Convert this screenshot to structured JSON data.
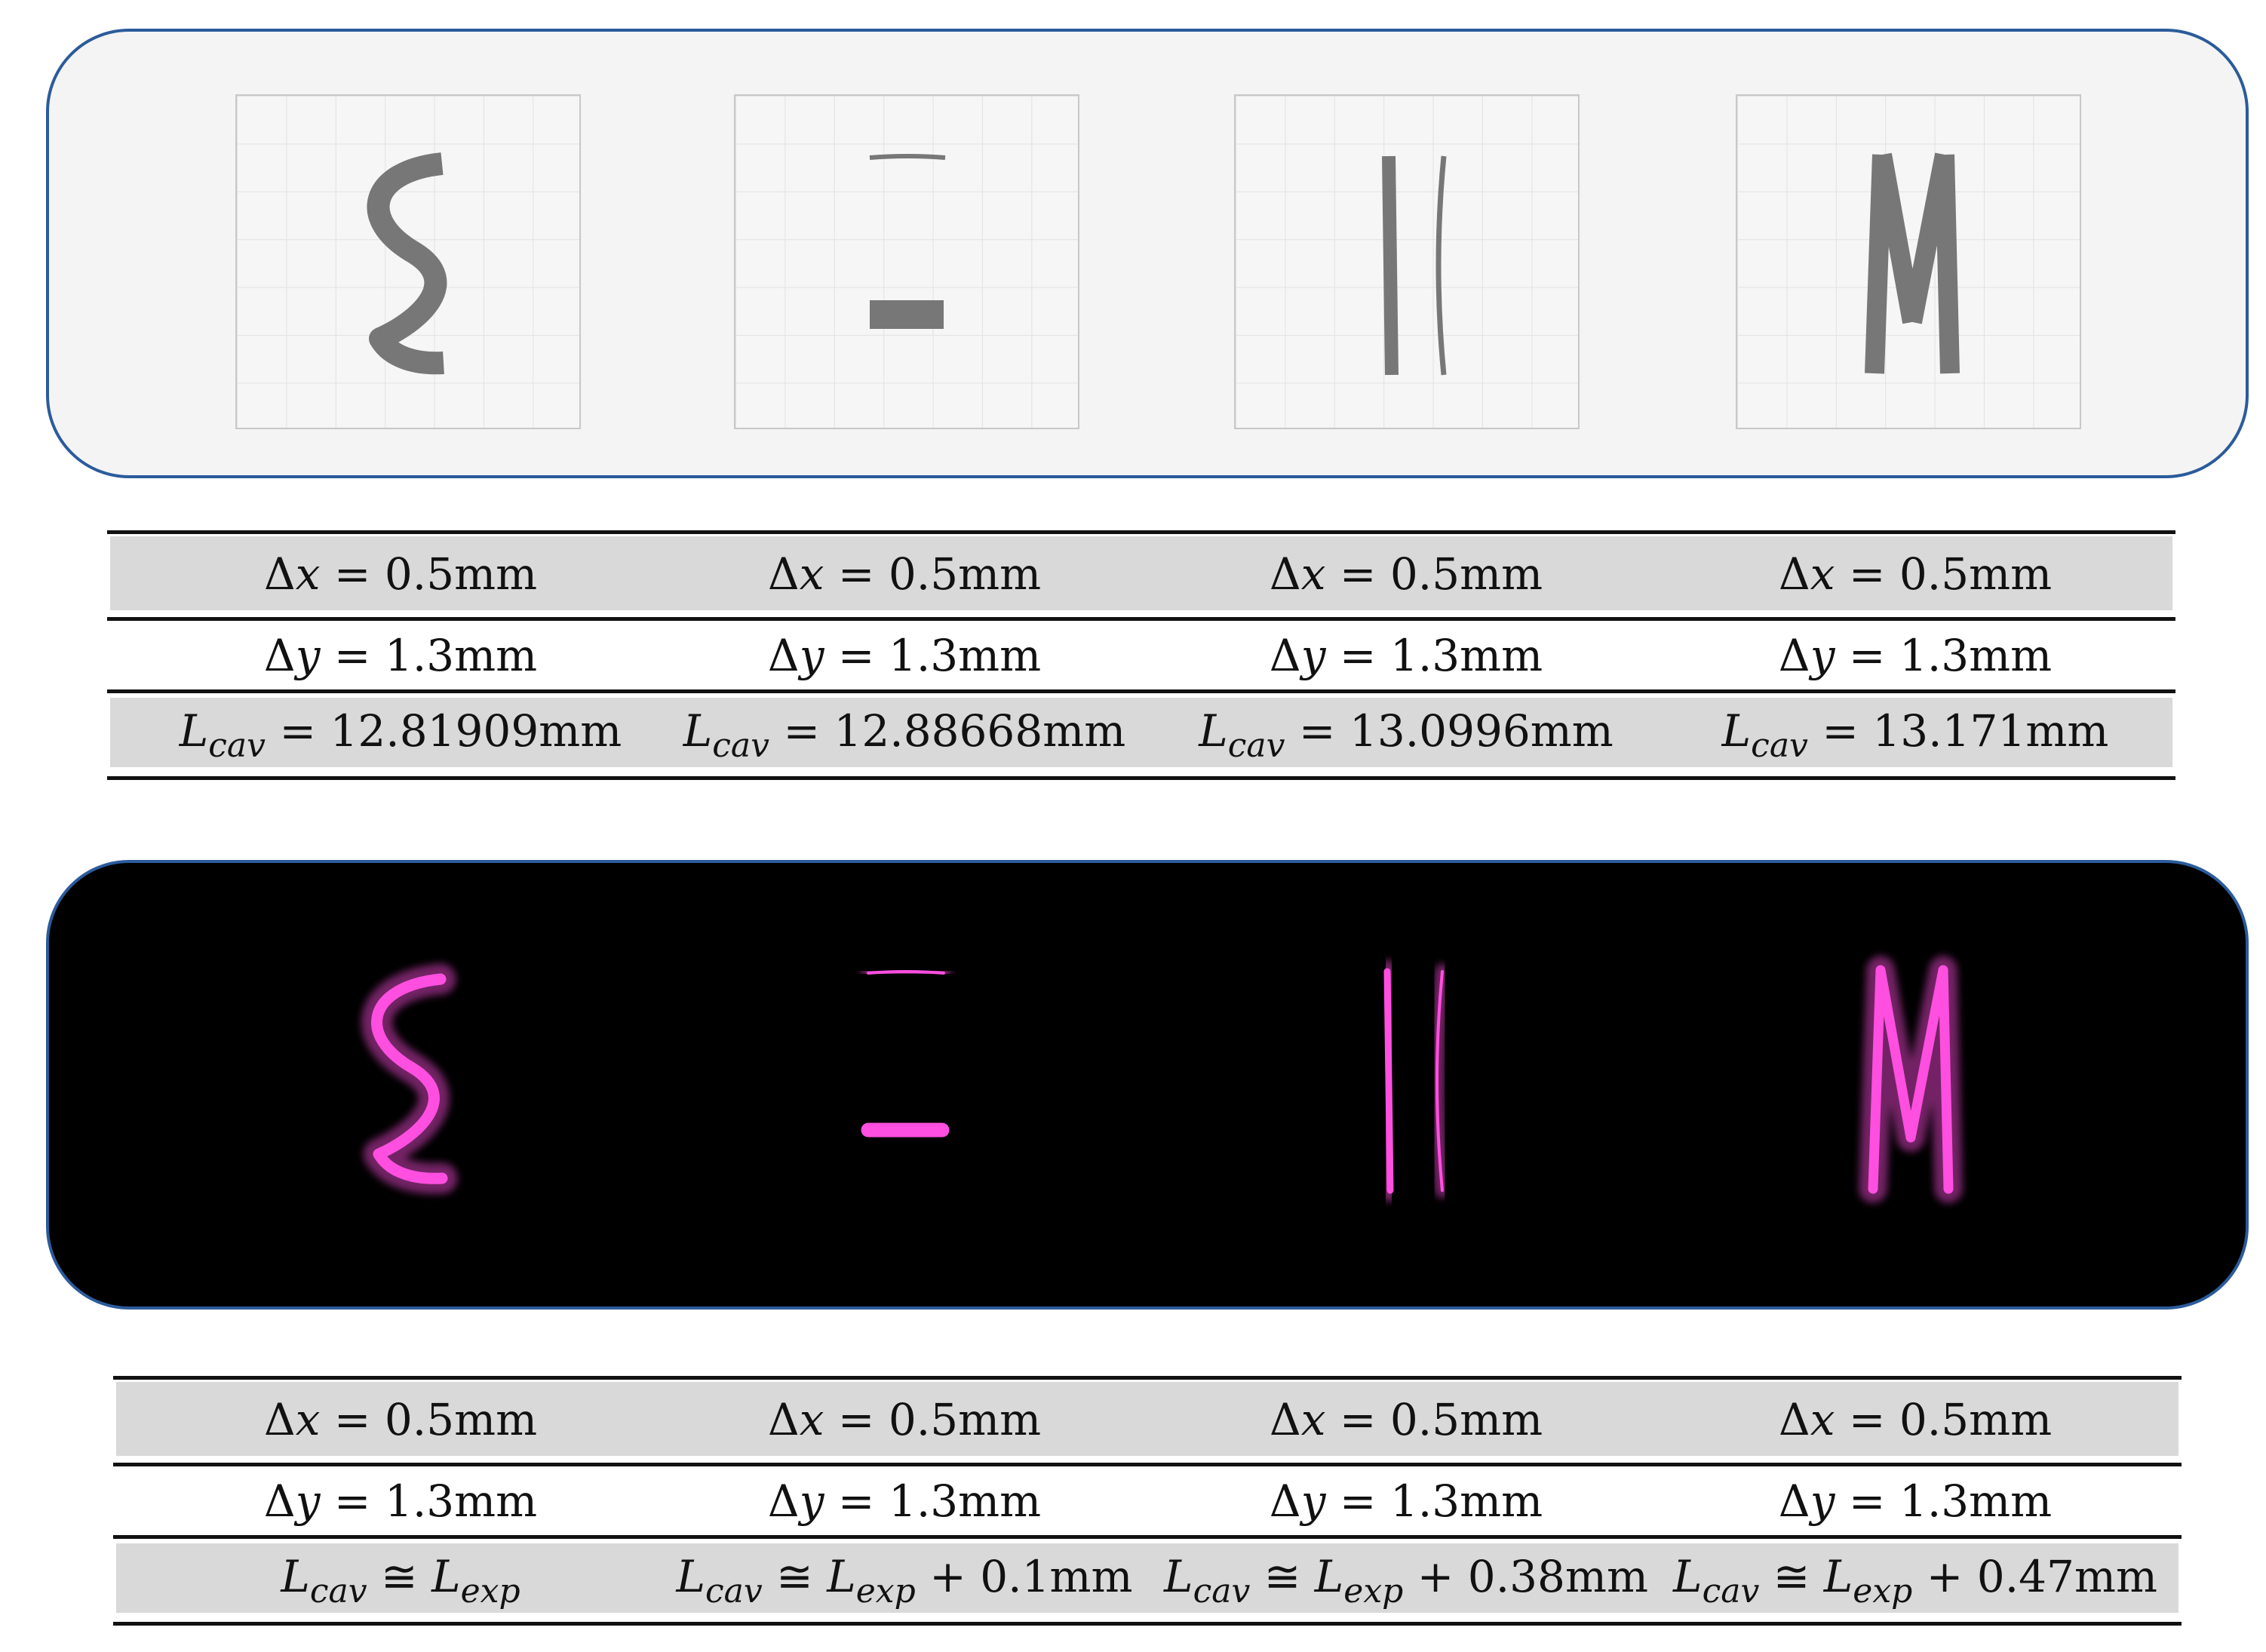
{
  "colors": {
    "panel_border": "#2b5b9b",
    "sim_shape": "#777777",
    "laser_glow": "#ff4fe0"
  },
  "simulation_panel": {
    "shapes": [
      "s-curve",
      "line-and-block",
      "two-vertical-lines",
      "m-shape"
    ]
  },
  "experiment_panel": {
    "shapes": [
      "s-curve",
      "line-and-block",
      "two-vertical-lines",
      "m-shape"
    ]
  },
  "table_top": {
    "rows": [
      [
        [
          {
            "t": "Δ"
          },
          {
            "i": "x"
          },
          {
            "t": " = 0.5mm"
          }
        ],
        [
          {
            "t": "Δ"
          },
          {
            "i": "x"
          },
          {
            "t": " = 0.5mm"
          }
        ],
        [
          {
            "t": "Δ"
          },
          {
            "i": "x"
          },
          {
            "t": " = 0.5mm"
          }
        ],
        [
          {
            "t": "Δ"
          },
          {
            "i": "x"
          },
          {
            "t": " = 0.5mm"
          }
        ]
      ],
      [
        [
          {
            "t": "Δ"
          },
          {
            "i": "y"
          },
          {
            "t": " = 1.3mm"
          }
        ],
        [
          {
            "t": "Δ"
          },
          {
            "i": "y"
          },
          {
            "t": " = 1.3mm"
          }
        ],
        [
          {
            "t": "Δ"
          },
          {
            "i": "y"
          },
          {
            "t": " = 1.3mm"
          }
        ],
        [
          {
            "t": "Δ"
          },
          {
            "i": "y"
          },
          {
            "t": " = 1.3mm"
          }
        ]
      ],
      [
        [
          {
            "i": "L"
          },
          {
            "sub": "cav"
          },
          {
            "t": " = 12.81909mm"
          }
        ],
        [
          {
            "i": "L"
          },
          {
            "sub": "cav"
          },
          {
            "t": " = 12.88668mm"
          }
        ],
        [
          {
            "i": "L"
          },
          {
            "sub": "cav"
          },
          {
            "t": " = 13.0996mm"
          }
        ],
        [
          {
            "i": "L"
          },
          {
            "sub": "cav"
          },
          {
            "t": " = 13.171mm"
          }
        ]
      ]
    ]
  },
  "table_bottom": {
    "rows": [
      [
        [
          {
            "t": "Δ"
          },
          {
            "i": "x"
          },
          {
            "t": " = 0.5mm"
          }
        ],
        [
          {
            "t": "Δ"
          },
          {
            "i": "x"
          },
          {
            "t": " = 0.5mm"
          }
        ],
        [
          {
            "t": "Δ"
          },
          {
            "i": "x"
          },
          {
            "t": " = 0.5mm"
          }
        ],
        [
          {
            "t": "Δ"
          },
          {
            "i": "x"
          },
          {
            "t": " = 0.5mm"
          }
        ]
      ],
      [
        [
          {
            "t": "Δ"
          },
          {
            "i": "y"
          },
          {
            "t": " = 1.3mm"
          }
        ],
        [
          {
            "t": "Δ"
          },
          {
            "i": "y"
          },
          {
            "t": " = 1.3mm"
          }
        ],
        [
          {
            "t": "Δ"
          },
          {
            "i": "y"
          },
          {
            "t": " = 1.3mm"
          }
        ],
        [
          {
            "t": "Δ"
          },
          {
            "i": "y"
          },
          {
            "t": " = 1.3mm"
          }
        ]
      ],
      [
        [
          {
            "i": "L"
          },
          {
            "sub": "cav"
          },
          {
            "t": " ≅ "
          },
          {
            "i": "L"
          },
          {
            "sub": "exp"
          }
        ],
        [
          {
            "i": "L"
          },
          {
            "sub": "cav"
          },
          {
            "t": " ≅ "
          },
          {
            "i": "L"
          },
          {
            "sub": "exp"
          },
          {
            "t": " + 0.1mm"
          }
        ],
        [
          {
            "i": "L"
          },
          {
            "sub": "cav"
          },
          {
            "t": " ≅ "
          },
          {
            "i": "L"
          },
          {
            "sub": "exp"
          },
          {
            "t": " + 0.38mm"
          }
        ],
        [
          {
            "i": "L"
          },
          {
            "sub": "cav"
          },
          {
            "t": " ≅ "
          },
          {
            "i": "L"
          },
          {
            "sub": "exp"
          },
          {
            "t": " + 0.47mm"
          }
        ]
      ]
    ]
  }
}
